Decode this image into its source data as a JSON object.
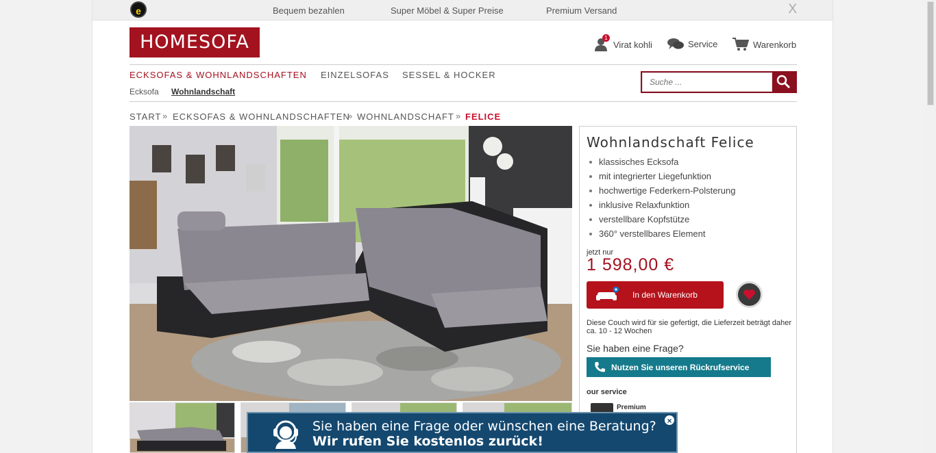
{
  "topbar": {
    "items": [
      "Bequem bezahlen",
      "Super Möbel & Super Preise",
      "Premium Versand"
    ],
    "seal_letter": "e",
    "close": "X"
  },
  "logo": "HOMESOFA",
  "user_links": {
    "user": "Virat kohli",
    "user_badge": "1",
    "service": "Service",
    "cart": "Warenkorb"
  },
  "nav": {
    "main": [
      "ECKSOFAS & WOHNLANDSCHAFTEN",
      "EINZELSOFAS",
      "SESSEL & HOCKER"
    ],
    "sub": [
      "Ecksofa",
      "Wohnlandschaft"
    ]
  },
  "search": {
    "placeholder": "Suche ..."
  },
  "breadcrumb": [
    "START",
    "ECKSOFAS & WOHNLANDSCHAFTEN",
    "WOHNLANDSCHAFT",
    "FELICE"
  ],
  "breadcrumb_sep": "»",
  "product": {
    "title": "Wohnlandschaft Felice",
    "features": [
      "klassisches Ecksofa",
      "mit integrierter Liegefunktion",
      "hochwertige Federkern-Polsterung",
      "inklusive Relaxfunktion",
      "verstellbare Kopfstütze",
      "360° verstellbares Element"
    ],
    "price_prefix": "jetzt nur",
    "price": "1 598,00 €",
    "cart_button": "In den Warenkorb",
    "delivery_note": "Diese Couch wird für sie gefertigt, die Lieferzeit beträgt daher ca. 10 - 12 Wochen",
    "question": "Sie haben eine Frage?",
    "callback_button": "Nutzen Sie unseren Rückrufservice",
    "service_heading": "our service",
    "service_item": "Premium"
  },
  "popup": {
    "line1": "Sie haben eine Frage oder wünschen eine Beratung?",
    "line2": "Wir rufen Sie kostenlos zurück!",
    "close": "×"
  },
  "colors": {
    "brand": "#a3121f",
    "callback": "#157a8b",
    "popup": "#14486f"
  }
}
